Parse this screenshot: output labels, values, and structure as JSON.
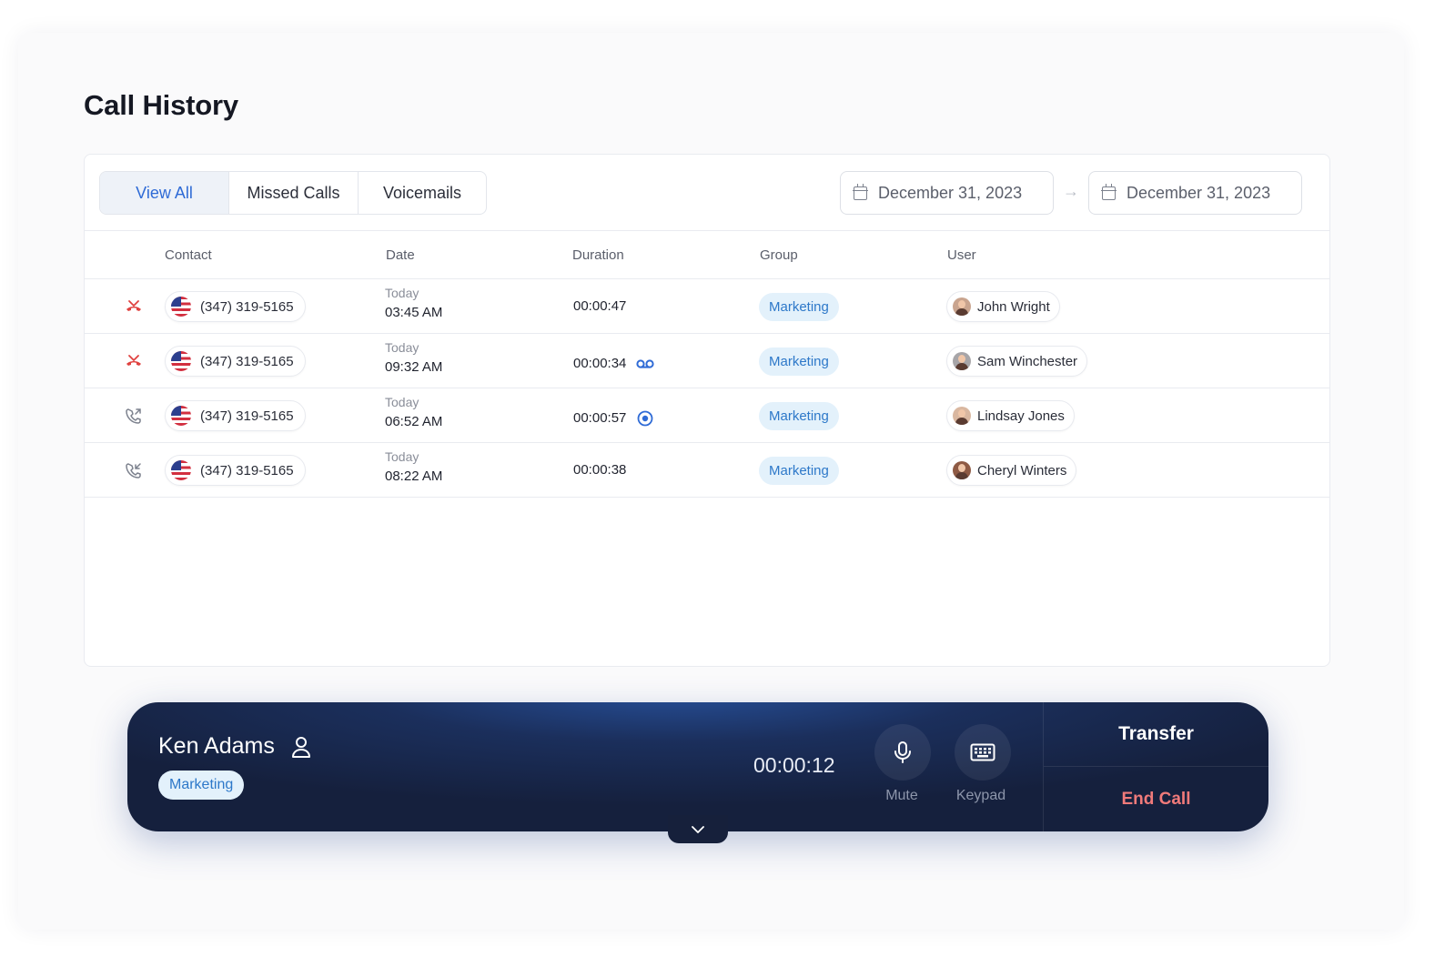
{
  "page": {
    "title": "Call History"
  },
  "tabs": [
    {
      "label": "View All",
      "active": true
    },
    {
      "label": "Missed Calls",
      "active": false
    },
    {
      "label": "Voicemails",
      "active": false
    }
  ],
  "date_range": {
    "from": "December 31, 2023",
    "to": "December 31, 2023"
  },
  "table": {
    "columns": [
      "Contact",
      "Date",
      "Duration",
      "Group",
      "User"
    ],
    "rows": [
      {
        "call_type": "missed-call-icon",
        "contact": "(347) 319-5165",
        "day": "Today",
        "time": "03:45 AM",
        "duration": "00:00:47",
        "extra_icon": "",
        "group": "Marketing",
        "user": "John Wright"
      },
      {
        "call_type": "missed-call-icon",
        "contact": "(347) 319-5165",
        "day": "Today",
        "time": "09:32 AM",
        "duration": "00:00:34",
        "extra_icon": "voicemail-icon",
        "group": "Marketing",
        "user": "Sam Winchester"
      },
      {
        "call_type": "outgoing-call-icon",
        "contact": "(347) 319-5165",
        "day": "Today",
        "time": "06:52 AM",
        "duration": "00:00:57",
        "extra_icon": "recording-icon",
        "group": "Marketing",
        "user": "Lindsay Jones"
      },
      {
        "call_type": "incoming-call-icon",
        "contact": "(347) 319-5165",
        "day": "Today",
        "time": "08:22 AM",
        "duration": "00:00:38",
        "extra_icon": "",
        "group": "Marketing",
        "user": "Cheryl Winters"
      }
    ]
  },
  "active_call": {
    "caller": "Ken Adams",
    "group": "Marketing",
    "timer": "00:00:12",
    "mute_label": "Mute",
    "keypad_label": "Keypad",
    "transfer_label": "Transfer",
    "end_label": "End Call"
  },
  "colors": {
    "accent": "#2f6bd6",
    "missed": "#e0413f",
    "end_call": "#f07a7a",
    "bar_bg": "#15203d"
  }
}
